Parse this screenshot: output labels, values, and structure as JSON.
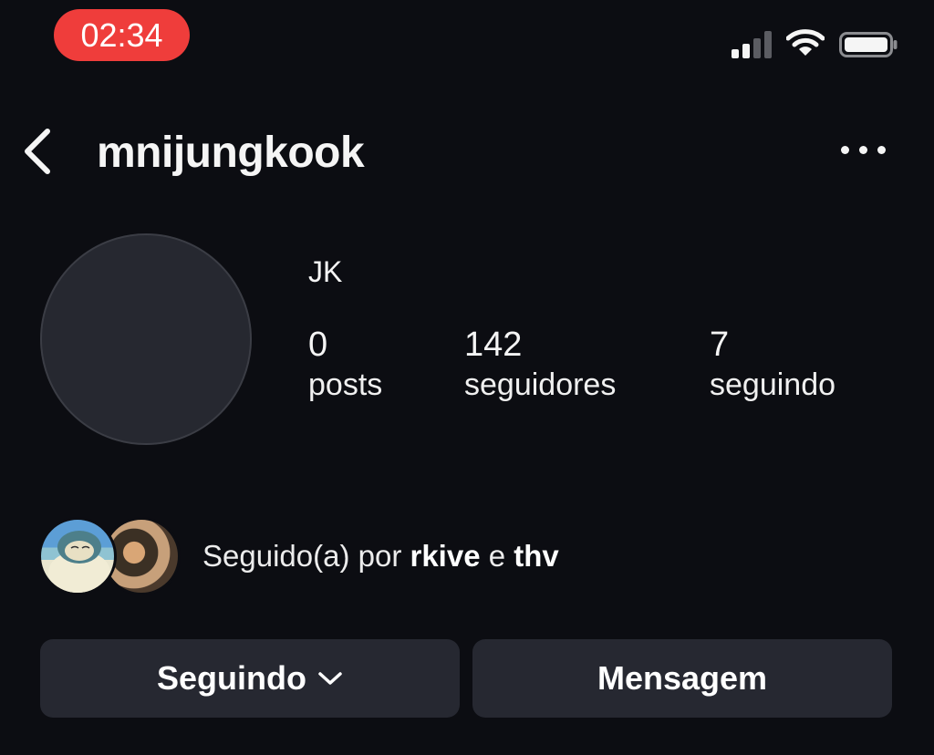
{
  "status_bar": {
    "time": "02:34"
  },
  "header": {
    "username": "mnijungkook"
  },
  "profile": {
    "display_name": "JK",
    "stats": [
      {
        "value": "0",
        "label": "posts"
      },
      {
        "value": "142",
        "label": "seguidores"
      },
      {
        "value": "7",
        "label": "seguindo"
      }
    ]
  },
  "followed_by": {
    "prefix": "Seguido(a) por",
    "user1": "rkive",
    "conjunction": "e",
    "user2": "thv"
  },
  "actions": {
    "following_label": "Seguindo",
    "message_label": "Mensagem"
  },
  "colors": {
    "background": "#0c0d12",
    "time_pill": "#ef3d3b",
    "button_bg": "#262831"
  },
  "icons": [
    "back-chevron-icon",
    "more-dots-icon",
    "cellular-signal-icon",
    "wifi-icon",
    "battery-icon",
    "chevron-down-icon"
  ]
}
